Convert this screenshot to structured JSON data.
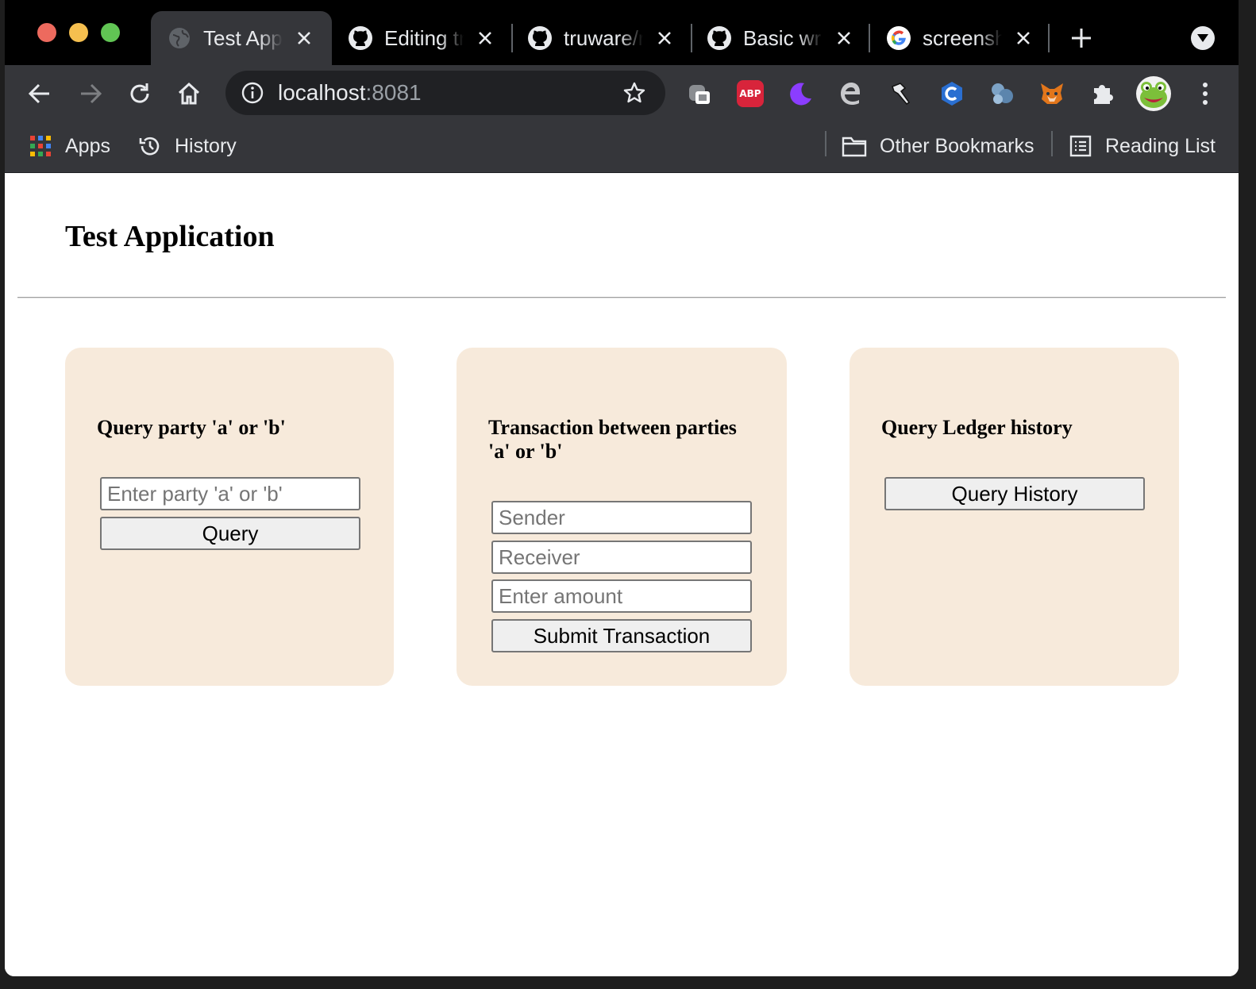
{
  "browser": {
    "tabs": [
      {
        "title": "Test App",
        "icon": "globe-icon"
      },
      {
        "title": "Editing tr",
        "icon": "github-icon"
      },
      {
        "title": "truware/r",
        "icon": "github-icon"
      },
      {
        "title": "Basic wri",
        "icon": "github-icon"
      },
      {
        "title": "screensh",
        "icon": "google-icon"
      }
    ],
    "url_host": "localhost",
    "url_port": ":8081",
    "bookmarks": {
      "apps": "Apps",
      "history": "History",
      "other": "Other Bookmarks",
      "reading_list": "Reading List"
    },
    "extensions": [
      "copy-icon",
      "abp-icon",
      "moon-icon",
      "edge-icon",
      "hammer-icon",
      "c-icon",
      "globe-ext-icon",
      "metamask-icon",
      "puzzle-icon",
      "frog-avatar"
    ],
    "abp_label": "ABP",
    "colors": {
      "tab_bg": "#000000",
      "toolbar_bg": "#35363a",
      "card_bg": "#f7eadb"
    }
  },
  "app": {
    "title": "Test Application",
    "cards": {
      "query_party": {
        "heading": "Query party 'a' or 'b'",
        "input_placeholder": "Enter party 'a' or 'b'",
        "button": "Query"
      },
      "transaction": {
        "heading": "Transaction between parties 'a' or 'b'",
        "sender_placeholder": "Sender",
        "receiver_placeholder": "Receiver",
        "amount_placeholder": "Enter amount",
        "button": "Submit Transaction"
      },
      "history": {
        "heading": "Query Ledger history",
        "button": "Query History"
      }
    }
  }
}
